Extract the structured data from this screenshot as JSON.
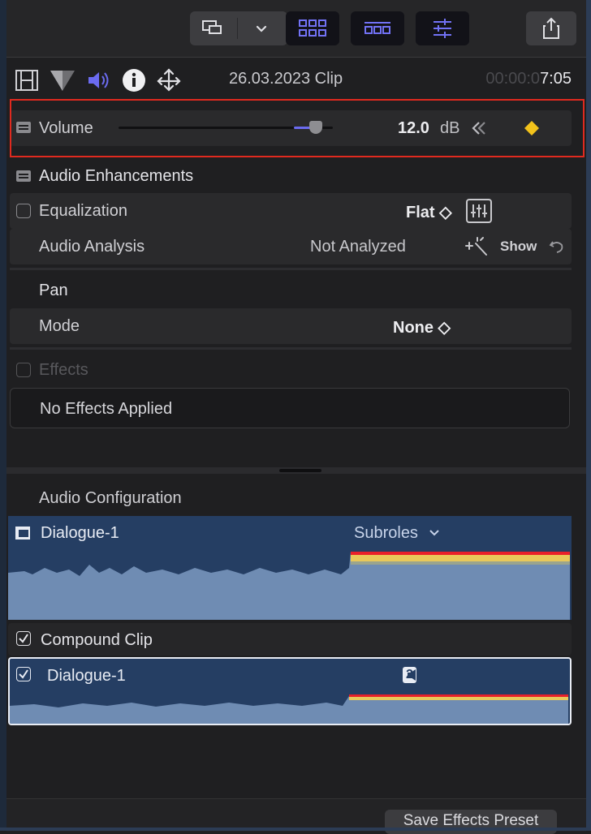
{
  "toolbar": {
    "buttons": [
      {
        "name": "display-options-icon"
      },
      {
        "name": "chevron-down-icon"
      },
      {
        "name": "browser-grid-icon"
      },
      {
        "name": "timeline-icon"
      },
      {
        "name": "inspector-sliders-icon"
      },
      {
        "name": "share-icon"
      }
    ],
    "active_color": "#6b6bf0"
  },
  "inspector": {
    "tabs": [
      "video-inspector-icon",
      "color-inspector-icon",
      "audio-inspector-icon",
      "info-inspector-icon",
      "transform-inspector-icon"
    ],
    "clip_title": "26.03.2023 Clip",
    "timecode_dim": "00:00:0",
    "timecode_bright": "7:05"
  },
  "volume": {
    "label": "Volume",
    "value": "12.0",
    "unit": "dB",
    "slider_fraction": 0.92,
    "keyframe_color": "#f2c21b"
  },
  "audio_enhancements": {
    "title": "Audio Enhancements",
    "equalization_label": "Equalization",
    "equalization_value": "Flat ◇",
    "analysis_label": "Audio Analysis",
    "analysis_value": "Not Analyzed",
    "show_label": "Show"
  },
  "pan": {
    "title": "Pan",
    "mode_label": "Mode",
    "mode_value": "None ◇"
  },
  "effects": {
    "title": "Effects",
    "empty_label": "No Effects Applied"
  },
  "audio_configuration": {
    "title": "Audio Configuration",
    "role_label": "Dialogue-1",
    "subroles_label": "Subroles",
    "compound_label": "Compound Clip",
    "component_label": "Dialogue-1",
    "channel_badge": "2"
  },
  "footer": {
    "save_preset_label": "Save Effects Preset"
  }
}
